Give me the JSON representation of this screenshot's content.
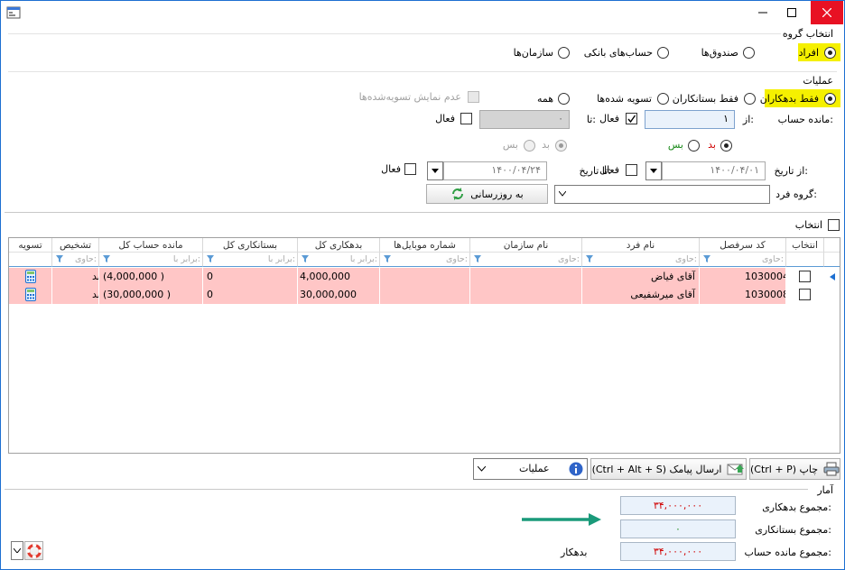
{
  "window": {
    "title": ""
  },
  "group_section": {
    "title": "انتخاب گروه",
    "options": [
      {
        "label": "افراد",
        "selected": true
      },
      {
        "label": "صندوق‌ها",
        "selected": false
      },
      {
        "label": "حساب‌های بانکی",
        "selected": false
      },
      {
        "label": "سازمان‌ها",
        "selected": false
      }
    ]
  },
  "ops_section": {
    "title": "عملیات",
    "filter_options": [
      {
        "label": "فقط بدهکاران",
        "selected": true
      },
      {
        "label": "فقط بستانکاران",
        "selected": false
      },
      {
        "label": "تسویه شده‌ها",
        "selected": false
      },
      {
        "label": "همه",
        "selected": false
      }
    ],
    "hide_settled_label": "عدم نمایش تسویه‌شده‌ها",
    "balance_label": "مانده حساب:",
    "from_label": "از:",
    "to_label": "تا:",
    "from_value": "۱",
    "to_value": "۰",
    "active_label": "فعال",
    "debtor_label": "بد",
    "creditor_label": "بس",
    "from_date_label": "از تاریخ:",
    "to_date_label": "تا تاریخ:",
    "from_date_value": "۱۴۰۰/۰۴/۰۱",
    "to_date_value": "۱۴۰۰/۰۴/۲۴",
    "person_group_label": "گروه فرد:",
    "person_group_value": "",
    "update_button": "به روزرسانی"
  },
  "select_all_label": "انتخاب",
  "table": {
    "columns": [
      "انتخاب",
      "کد سرفصل",
      "نام فرد",
      "نام سازمان",
      "شماره موبایل‌ها",
      "بدهکاری کل",
      "بستانکاری کل",
      "مانده حساب کل",
      "تشخیص",
      "تسویه"
    ],
    "filter_hints": [
      "",
      "حاوی:",
      "حاوی:",
      "حاوی:",
      "حاوی:",
      "برابر با:",
      "برابر با:",
      "برابر با:",
      "حاوی:",
      ""
    ],
    "rows": [
      {
        "code": "1030004",
        "name": "آقای فیاض",
        "org": "",
        "mobile": "",
        "debit": "4,000,000",
        "credit": "0",
        "balance": "(4,000,000 )",
        "status": "بد"
      },
      {
        "code": "1030008",
        "name": "آقای میرشفیعی",
        "org": "",
        "mobile": "",
        "debit": "30,000,000",
        "credit": "0",
        "balance": "(30,000,000 )",
        "status": "بد"
      }
    ]
  },
  "toolbar": {
    "print_label": "(Ctrl + P) چاپ",
    "sms_label": "(Ctrl + Alt + S) ارسال پیامک",
    "ops_label": "عملیات"
  },
  "stats": {
    "title": "آمار",
    "total_debit_label": "مجموع بدهکاری:",
    "total_debit_value": "۳۴,۰۰۰,۰۰۰",
    "total_credit_label": "مجموع بستانکاری:",
    "total_credit_value": "۰",
    "total_balance_label": "مجموع مانده حساب:",
    "total_balance_value": "۳۴,۰۰۰,۰۰۰",
    "balance_status": "بدهکار"
  },
  "colors": {
    "highlight": "#f5f000",
    "row_bg": "#ffc6c6",
    "accent": "#1d6fd1",
    "arrow": "#1a9a7a"
  }
}
